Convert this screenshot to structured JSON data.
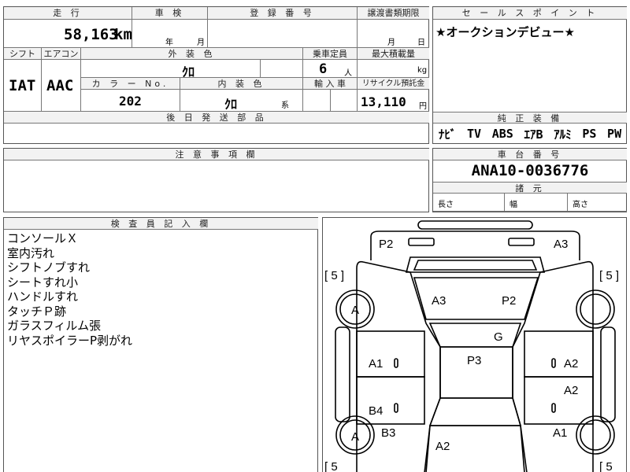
{
  "header_row": {
    "distance_label": "走 行",
    "inspection_label": "車 検",
    "registration_label": "登 録 番 号",
    "transfer_label": "譲渡書類期限",
    "selling_point_label": "セ ー ル ス ポ イ ン ト"
  },
  "mileage": {
    "value": "58,163",
    "unit": "km"
  },
  "inspection": {
    "year_unit": "年",
    "month_unit": "月"
  },
  "transfer": {
    "month_unit": "月",
    "day_unit": "日"
  },
  "selling_point": {
    "text": "★オークションデビュー★"
  },
  "spec_labels": {
    "shift": "シフト",
    "aircon": "エアコン",
    "exterior_color": "外 装 色",
    "capacity": "乗車定員",
    "max_load": "最大積載量",
    "color_no": "カ ラ ー No.",
    "interior_color": "内 装 色",
    "import": "輸 入 車",
    "recycle_fee": "リサイクル預託金",
    "later_parts": "後 日 発 送 部 品"
  },
  "specs": {
    "shift": "IAT",
    "aircon": "AAC",
    "exterior_color": "ｸﾛ",
    "capacity": "6",
    "capacity_unit": "人",
    "load_unit": "kg",
    "color_no": "202",
    "interior_color": "ｸﾛ",
    "interior_suffix": "系",
    "recycle_fee": "13,110",
    "recycle_unit": "円"
  },
  "equipment": {
    "label": "純 正 装 備",
    "items": [
      "ﾅﾋﾞ",
      "TV",
      "ABS",
      "ｴｱB",
      "ｱﾙﾐ",
      "PS",
      "PW"
    ]
  },
  "notes": {
    "label": "注 意 事 項 欄"
  },
  "chassis": {
    "label": "車 台 番 号",
    "value": "ANA10-0036776",
    "dims_label": "諸 元",
    "length": "長さ",
    "width": "幅",
    "height": "高さ"
  },
  "inspector": {
    "label": "検 査 員 記 入 欄",
    "lines": [
      "コンソールＸ",
      "室内汚れ",
      "シフトノブすれ",
      "シートすれ小",
      "ハンドルすれ",
      "タッチＰ跡",
      "ガラスフィルム張",
      "リヤスポイラーP剥がれ"
    ]
  },
  "diagram": {
    "marks": {
      "rear_left": "P2",
      "rear_right": "A3",
      "rear_window_left": "A3",
      "rear_window_right": "P2",
      "roof_g": "G",
      "roof_p3": "P3",
      "left_rear_door": "A1",
      "left_front_door": "B4",
      "left_front_fender": "B3",
      "right_rear_quarter": "A2",
      "right_rear_door": "A2",
      "right_front_fender": "A1",
      "hood": "A2",
      "tire_rear_left": "A",
      "tire_front_left": "A"
    },
    "tread": {
      "top_left": "[ 5 ]",
      "top_right": "[ 5 ]",
      "bottom_left": "[ 5",
      "bottom_right": "[ 5"
    },
    "zero_marks": "0"
  }
}
